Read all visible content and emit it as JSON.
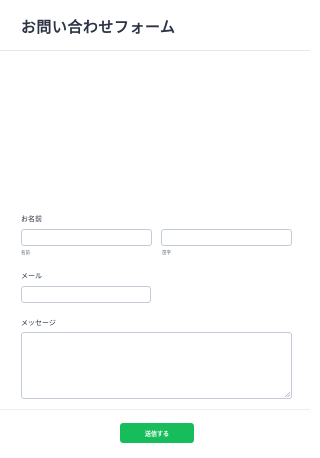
{
  "form": {
    "title": "お問い合わせフォーム",
    "name_section": {
      "label": "お名前",
      "first_name_sublabel": "名前",
      "last_name_sublabel": "苗字",
      "first_name_value": "",
      "last_name_value": ""
    },
    "email_section": {
      "label": "メール",
      "value": ""
    },
    "message_section": {
      "label": "メッセージ",
      "value": ""
    },
    "submit_label": "送信する"
  },
  "colors": {
    "submit_button": "#18bd5b",
    "input_border": "#c3cad8",
    "text": "#2c3345"
  }
}
